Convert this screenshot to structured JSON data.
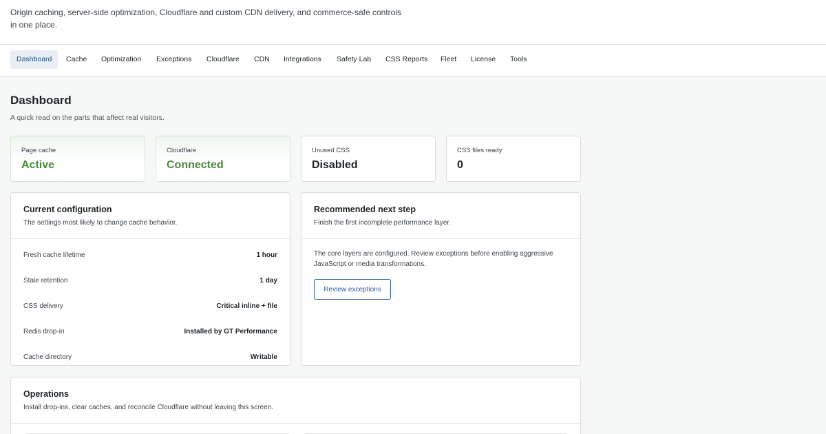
{
  "header": {
    "description": "Origin caching, server-side optimization, Cloudflare and custom CDN delivery, and commerce-safe controls in one place."
  },
  "tabs": [
    {
      "label": "Dashboard",
      "active": true
    },
    {
      "label": "Cache"
    },
    {
      "label": "Optimization"
    },
    {
      "label": "Exceptions"
    },
    {
      "label": "Cloudflare"
    },
    {
      "label": "CDN"
    },
    {
      "label": "Integrations"
    },
    {
      "label": "Safety Lab"
    },
    {
      "label": "CSS Reports"
    },
    {
      "label": "Fleet"
    },
    {
      "label": "License"
    },
    {
      "label": "Tools"
    }
  ],
  "page": {
    "title": "Dashboard",
    "subtitle": "A quick read on the parts that affect real visitors."
  },
  "stats": [
    {
      "label": "Page cache",
      "value": "Active",
      "status_color": "#4a8a3a"
    },
    {
      "label": "Cloudflare",
      "value": "Connected",
      "status_color": "#4a8a3a"
    },
    {
      "label": "Unused CSS",
      "value": "Disabled"
    },
    {
      "label": "CSS files ready",
      "value": "0"
    }
  ],
  "config": {
    "title": "Current configuration",
    "subtitle": "The settings most likely to change cache behavior.",
    "rows": [
      {
        "label": "Fresh cache lifetime",
        "value": "1 hour"
      },
      {
        "label": "Stale retention",
        "value": "1 day"
      },
      {
        "label": "CSS delivery",
        "value": "Critical inline + file"
      },
      {
        "label": "Redis drop-in",
        "value": "Installed by GT Performance"
      },
      {
        "label": "Cache directory",
        "value": "Writable"
      }
    ]
  },
  "recommended": {
    "title": "Recommended next step",
    "subtitle": "Finish the first incomplete performance layer.",
    "body": "The core layers are configured. Review exceptions before enabling aggressive JavaScript or media transformations.",
    "button_label": "Review exceptions"
  },
  "operations": {
    "title": "Operations",
    "subtitle": "Install drop-ins, clear caches, and reconcile Cloudflare without leaving this screen."
  },
  "colors": {
    "accent": "#2c5aa0",
    "active_tab_bg": "#e8eef4",
    "success": "#4a8a3a"
  }
}
